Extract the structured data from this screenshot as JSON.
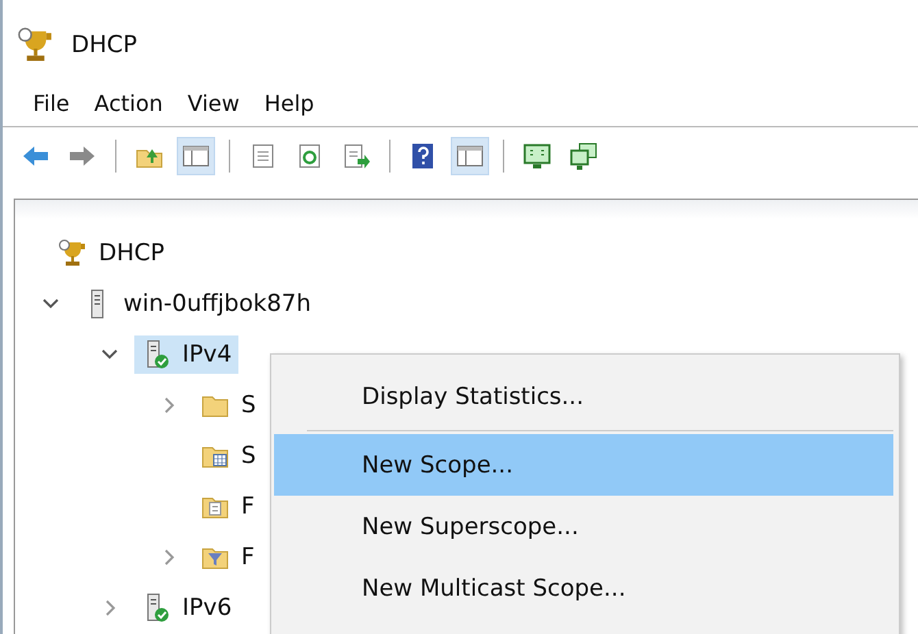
{
  "window": {
    "title": "DHCP"
  },
  "menu_bar": [
    "File",
    "Action",
    "View",
    "Help"
  ],
  "toolbar": [
    {
      "kind": "back",
      "pressed": false
    },
    {
      "kind": "forward",
      "pressed": false
    },
    {
      "kind": "separator"
    },
    {
      "kind": "up-folder",
      "pressed": false
    },
    {
      "kind": "pane",
      "pressed": true
    },
    {
      "kind": "separator"
    },
    {
      "kind": "document",
      "pressed": false
    },
    {
      "kind": "refresh",
      "pressed": false
    },
    {
      "kind": "export",
      "pressed": false
    },
    {
      "kind": "separator"
    },
    {
      "kind": "help",
      "pressed": false
    },
    {
      "kind": "pane",
      "pressed": true
    },
    {
      "kind": "separator"
    },
    {
      "kind": "monitor",
      "pressed": false
    },
    {
      "kind": "monitors",
      "pressed": false
    }
  ],
  "tree": [
    {
      "label": "DHCP",
      "kind": "trophy",
      "selected": false,
      "children": [
        {
          "label": "win-0uffjbok87h",
          "kind": "server",
          "selected": false,
          "expanded": true,
          "children": [
            {
              "label": "IPv4",
              "kind": "server-check",
              "selected": true,
              "expanded": true,
              "children": [
                {
                  "label": "S",
                  "kind": "folder",
                  "selected": false,
                  "expanded": false
                },
                {
                  "label": "S",
                  "kind": "folder-grid",
                  "selected": false
                },
                {
                  "label": "F",
                  "kind": "folder-doc",
                  "selected": false
                },
                {
                  "label": "F",
                  "kind": "folder-filter",
                  "selected": false,
                  "expanded": false
                }
              ]
            },
            {
              "label": "IPv6",
              "kind": "server-check",
              "selected": false,
              "expanded": false
            }
          ]
        }
      ]
    }
  ],
  "context_menu": [
    {
      "kind": "item",
      "label": "Display Statistics...",
      "selected": false
    },
    {
      "kind": "separator"
    },
    {
      "kind": "item",
      "label": "New Scope...",
      "selected": true
    },
    {
      "kind": "item",
      "label": "New Superscope...",
      "selected": false
    },
    {
      "kind": "item",
      "label": "New Multicast Scope...",
      "selected": false
    }
  ]
}
